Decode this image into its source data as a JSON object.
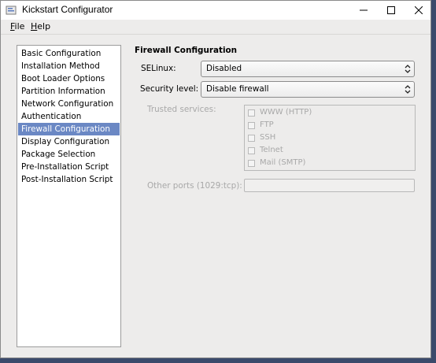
{
  "window": {
    "title": "Kickstart Configurator",
    "controls": {
      "minimize": "minimize",
      "maximize": "maximize",
      "close": "close"
    }
  },
  "menu": {
    "file": "File",
    "help": "Help"
  },
  "sidebar": {
    "items": [
      {
        "label": "Basic Configuration"
      },
      {
        "label": "Installation Method"
      },
      {
        "label": "Boot Loader Options"
      },
      {
        "label": "Partition Information"
      },
      {
        "label": "Network Configuration"
      },
      {
        "label": "Authentication"
      },
      {
        "label": "Firewall Configuration",
        "selected": true
      },
      {
        "label": "Display Configuration"
      },
      {
        "label": "Package Selection"
      },
      {
        "label": "Pre-Installation Script"
      },
      {
        "label": "Post-Installation Script"
      }
    ]
  },
  "firewall": {
    "title": "Firewall Configuration",
    "selinux": {
      "label": "SELinux:",
      "value": "Disabled"
    },
    "security_level": {
      "label": "Security level:",
      "value": "Disable firewall"
    },
    "trusted_services": {
      "label": "Trusted services:",
      "items": [
        {
          "label": "WWW (HTTP)",
          "checked": false
        },
        {
          "label": "FTP",
          "checked": false
        },
        {
          "label": "SSH",
          "checked": false
        },
        {
          "label": "Telnet",
          "checked": false
        },
        {
          "label": "Mail (SMTP)",
          "checked": false
        }
      ]
    },
    "other_ports": {
      "label": "Other ports (1029:tcp):",
      "value": ""
    }
  },
  "colors": {
    "selection": "#6b88c4",
    "window_bg": "#edeceb",
    "disabled_text": "#a8a8a8"
  }
}
